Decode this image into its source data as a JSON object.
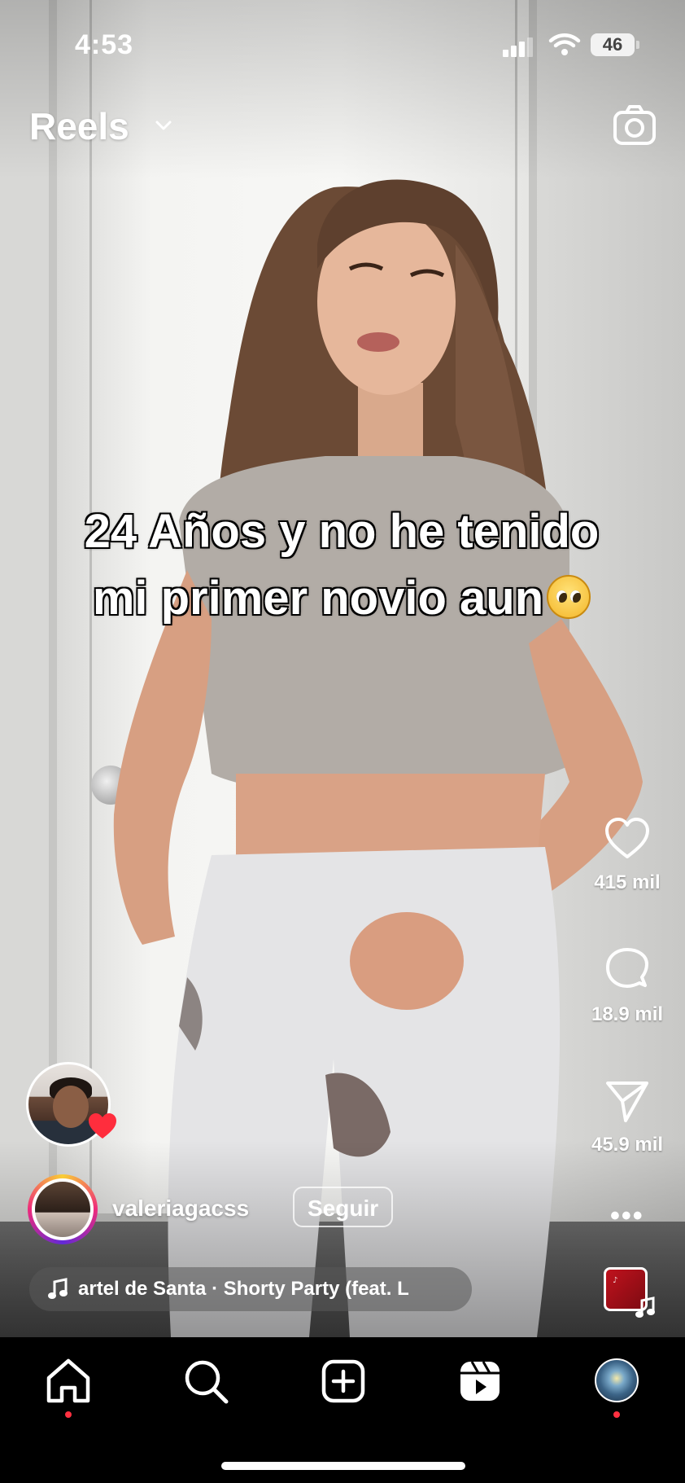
{
  "status_bar": {
    "time": "4:53",
    "battery": "46"
  },
  "header": {
    "title": "Reels"
  },
  "caption": {
    "line1": "24 Años y no he tenido",
    "line2": "mi primer novio aun"
  },
  "actions": {
    "likes": "415 mil",
    "comments": "18.9 mil",
    "shares": "45.9 mil",
    "more": "•••"
  },
  "author": {
    "username": "valeriagacss",
    "follow_label": "Seguir"
  },
  "audio": {
    "track": "artel de Santa · Shorty Party (feat. L"
  },
  "colors": {
    "accent_red": "#ff3040",
    "text": "#ffffff",
    "tabbar_bg": "#000000"
  },
  "icons": [
    "camera-icon",
    "heart-icon",
    "comment-icon",
    "send-icon",
    "more-icon",
    "music-note-icon",
    "home-icon",
    "search-icon",
    "create-icon",
    "reels-icon",
    "profile-icon"
  ]
}
